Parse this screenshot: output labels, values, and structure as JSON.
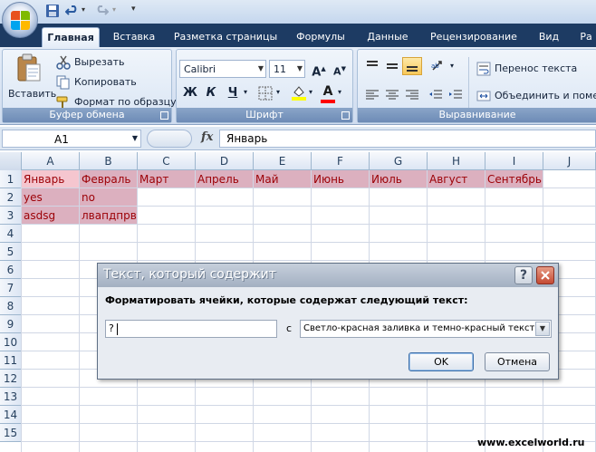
{
  "ribbon": {
    "tabs": [
      {
        "label": "Главная",
        "active": true
      },
      {
        "label": "Вставка"
      },
      {
        "label": "Разметка страницы"
      },
      {
        "label": "Формулы"
      },
      {
        "label": "Данные"
      },
      {
        "label": "Рецензирование"
      },
      {
        "label": "Вид"
      },
      {
        "label": "Ра"
      }
    ],
    "clipboard": {
      "paste": "Вставить",
      "cut": "Вырезать",
      "copy": "Копировать",
      "format_painter": "Формат по образцу",
      "group_label": "Буфер обмена"
    },
    "font": {
      "font_name": "Calibri",
      "font_size": "11",
      "bold": "Ж",
      "italic": "К",
      "underline": "Ч",
      "group_label": "Шрифт",
      "fill_color": "#ffff00",
      "text_color": "#ff0000"
    },
    "alignment": {
      "wrap_text": "Перенос текста",
      "merge_center": "Объединить и помес",
      "group_label": "Выравнивание"
    }
  },
  "formula_bar": {
    "name_box": "A1",
    "fx": "fx",
    "formula": "Январь"
  },
  "grid": {
    "columns": [
      "A",
      "B",
      "C",
      "D",
      "E",
      "F",
      "G",
      "H",
      "I",
      "J"
    ],
    "rows": [
      "1",
      "2",
      "3",
      "4",
      "5",
      "6",
      "7",
      "8",
      "9",
      "10",
      "11",
      "12",
      "13",
      "14",
      "15"
    ],
    "cells": {
      "A1": "Январь",
      "B1": "Февраль",
      "C1": "Март",
      "D1": "Апрель",
      "E1": "Май",
      "F1": "Июнь",
      "G1": "Июль",
      "H1": "Август",
      "I1": "Сентябрь",
      "A2": "yes",
      "B2": "no",
      "A3": "asdsg",
      "B3": "лвапдпрв"
    },
    "highlight_fill": "#dcb0bf",
    "highlight_text": "#9c0006"
  },
  "dialog": {
    "title": "Текст, который содержит",
    "help": "?",
    "close": "X",
    "prompt": "Форматировать ячейки, которые содержат следующий текст:",
    "input_value": "?",
    "with_label": "с",
    "format_option": "Светло-красная заливка и темно-красный текст",
    "ok": "OK",
    "cancel": "Отмена"
  },
  "watermark": "www.excelworld.ru"
}
